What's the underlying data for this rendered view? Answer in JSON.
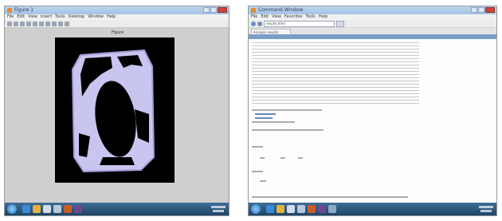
{
  "left_window": {
    "title": "Figure 1",
    "menu": [
      "File",
      "Edit",
      "View",
      "Insert",
      "Tools",
      "Desktop",
      "Window",
      "Help"
    ],
    "figure_title": "Figure",
    "plot_colors": {
      "background": "#000000",
      "region": "#c8c6f0",
      "outline": "#a19ed8",
      "hole": "#000000"
    }
  },
  "right_window": {
    "title": "Command Window",
    "menu": [
      "File",
      "Edit",
      "View",
      "Favorites",
      "Tools",
      "Help"
    ],
    "address": "results.html",
    "tab_label": "Analysis results"
  },
  "taskbar": {
    "icons": [
      "windows-start-icon",
      "ie-icon",
      "folder-icon",
      "media-icon",
      "app-icon",
      "app-icon",
      "matlab-icon",
      "app-icon"
    ],
    "clock_time": "",
    "clock_date": ""
  }
}
